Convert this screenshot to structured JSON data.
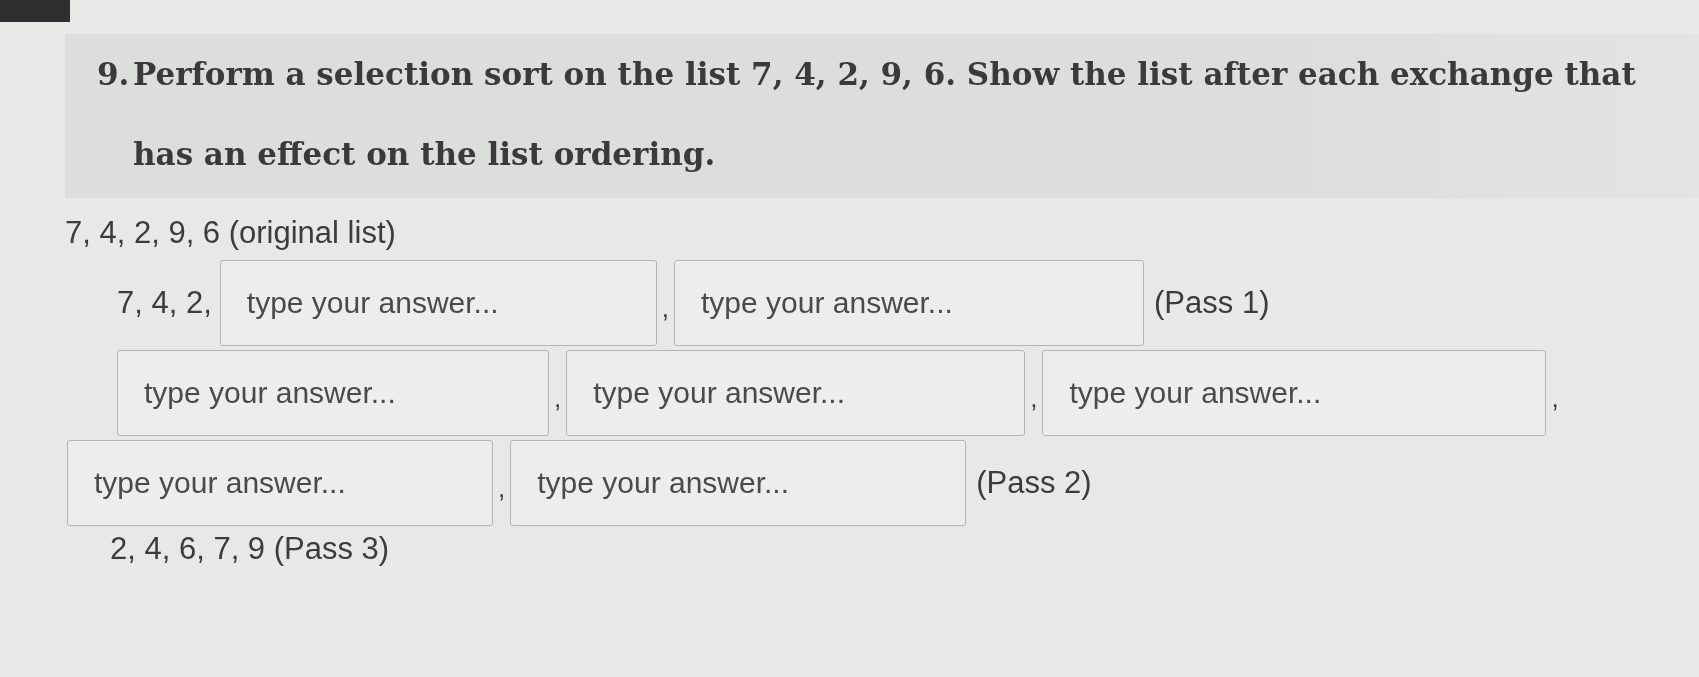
{
  "question": {
    "number": "9.",
    "text": "Perform a selection sort on the list 7, 4, 2, 9, 6. Show the list after each exchange that has an effect on the list ordering."
  },
  "lines": [
    {
      "items": [
        {
          "kind": "text",
          "text": "7, 4, 2, 9, 6 (original list)"
        }
      ]
    },
    {
      "items": [
        {
          "kind": "text",
          "text": "7, 4, 2,"
        },
        {
          "kind": "field",
          "placeholder": "type your answer..."
        },
        {
          "kind": "separator",
          "text": ","
        },
        {
          "kind": "field",
          "placeholder": "type your answer..."
        },
        {
          "kind": "text",
          "text": "(Pass 1)"
        }
      ]
    },
    {
      "items": [
        {
          "kind": "field",
          "placeholder": "type your answer..."
        },
        {
          "kind": "separator",
          "text": ","
        },
        {
          "kind": "field",
          "placeholder": "type your answer..."
        },
        {
          "kind": "separator",
          "text": ","
        },
        {
          "kind": "field",
          "placeholder": "type your answer..."
        },
        {
          "kind": "separator",
          "text": ","
        }
      ]
    },
    {
      "items": [
        {
          "kind": "field",
          "placeholder": "type your answer..."
        },
        {
          "kind": "separator",
          "text": ","
        },
        {
          "kind": "field",
          "placeholder": "type your answer..."
        },
        {
          "kind": "text",
          "text": "(Pass 2)"
        }
      ]
    },
    {
      "items": [
        {
          "kind": "text",
          "text": "2, 4, 6, 7, 9 (Pass 3)"
        }
      ]
    }
  ]
}
